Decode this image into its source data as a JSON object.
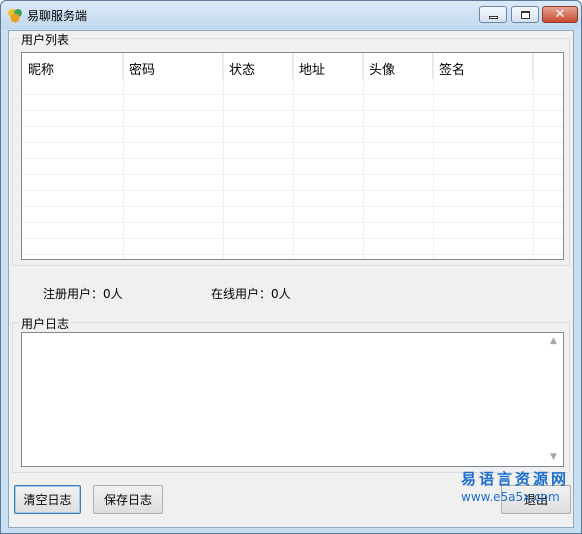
{
  "window": {
    "title": "易聊服务端",
    "controls": {
      "minimize": "minimize",
      "maximize": "maximize",
      "close": "✕"
    }
  },
  "user_list": {
    "group_label": "用户列表",
    "columns": [
      "昵称",
      "密码",
      "状态",
      "地址",
      "头像",
      "签名"
    ],
    "rows": []
  },
  "stats": {
    "registered_label": "注册用户：",
    "registered_value": "0人",
    "online_label": "在线用户：",
    "online_value": "0人"
  },
  "user_log": {
    "group_label": "用户日志",
    "content": ""
  },
  "buttons": {
    "clear_log": "清空日志",
    "save_log": "保存日志",
    "exit": "退出"
  },
  "watermark": {
    "brand": "易语言资源网",
    "url": "www.e5a5x.com"
  },
  "colors": {
    "titlebar": "#c9dff2",
    "close_button": "#c84a32",
    "watermark": "#1f6fd0"
  }
}
